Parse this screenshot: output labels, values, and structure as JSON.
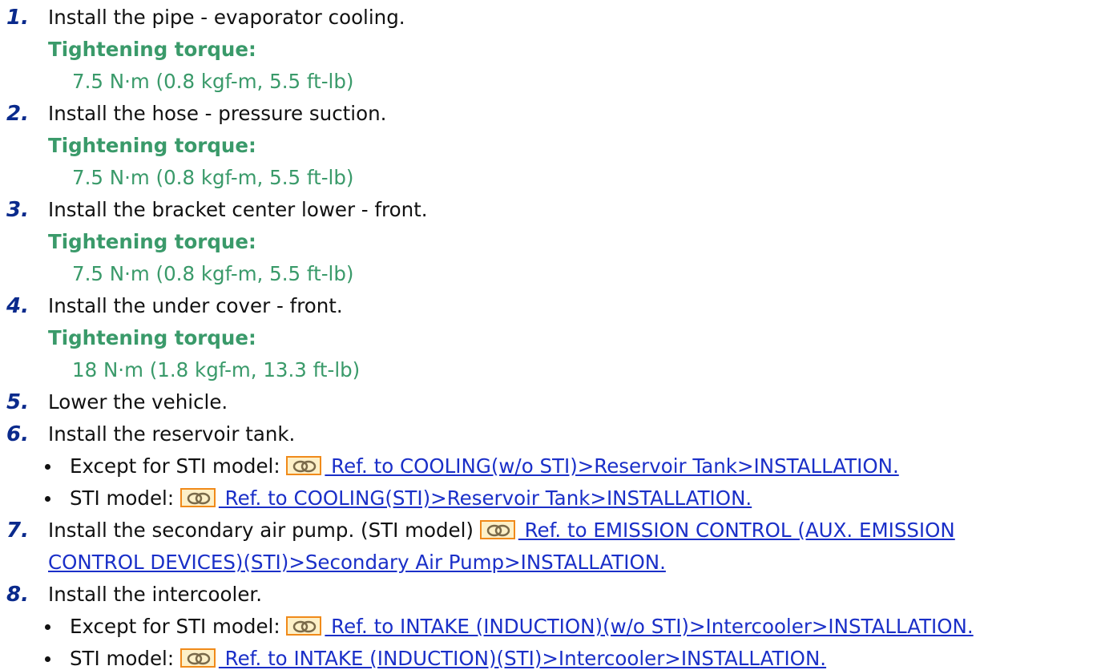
{
  "steps": [
    {
      "num": "1.",
      "text": "Install the pipe - evaporator cooling.",
      "torque_label": "Tightening torque:",
      "torque_value": "7.5 N·m (0.8 kgf-m, 5.5 ft-lb)"
    },
    {
      "num": "2.",
      "text": "Install the hose - pressure suction.",
      "torque_label": "Tightening torque:",
      "torque_value": "7.5 N·m (0.8 kgf-m, 5.5 ft-lb)"
    },
    {
      "num": "3.",
      "text": "Install the bracket center lower - front.",
      "torque_label": "Tightening torque:",
      "torque_value": "7.5 N·m (0.8 kgf-m, 5.5 ft-lb)"
    },
    {
      "num": "4.",
      "text": "Install the under cover - front.",
      "torque_label": "Tightening torque:",
      "torque_value": "18 N·m (1.8 kgf-m, 13.3 ft-lb)"
    },
    {
      "num": "5.",
      "text": "Lower the vehicle."
    },
    {
      "num": "6.",
      "text": "Install the reservoir tank.",
      "bullets": [
        {
          "label": "Except for STI model:",
          "link": " Ref. to COOLING(w/o STI)>Reservoir Tank>INSTALLATION."
        },
        {
          "label": "STI model:",
          "link": " Ref. to COOLING(STI)>Reservoir Tank>INSTALLATION."
        }
      ]
    },
    {
      "num": "7.",
      "text": "Install the secondary air pump. (STI model)",
      "link_line1": " Ref. to EMISSION CONTROL (AUX. EMISSION",
      "link_line2": "CONTROL DEVICES)(STI)>Secondary Air Pump>INSTALLATION."
    },
    {
      "num": "8.",
      "text": "Install the intercooler.",
      "bullets": [
        {
          "label": "Except for STI model:",
          "link": " Ref. to INTAKE (INDUCTION)(w/o STI)>Intercooler>INSTALLATION."
        },
        {
          "label": "STI model:",
          "link": " Ref. to INTAKE (INDUCTION)(STI)>Intercooler>INSTALLATION."
        }
      ]
    }
  ],
  "icons": {
    "link": "chain-link-icon"
  },
  "colors": {
    "step_number": "#0a2a8c",
    "torque": "#3a9a6a",
    "link": "#1a2fc8",
    "icon_border": "#f08a1a"
  }
}
